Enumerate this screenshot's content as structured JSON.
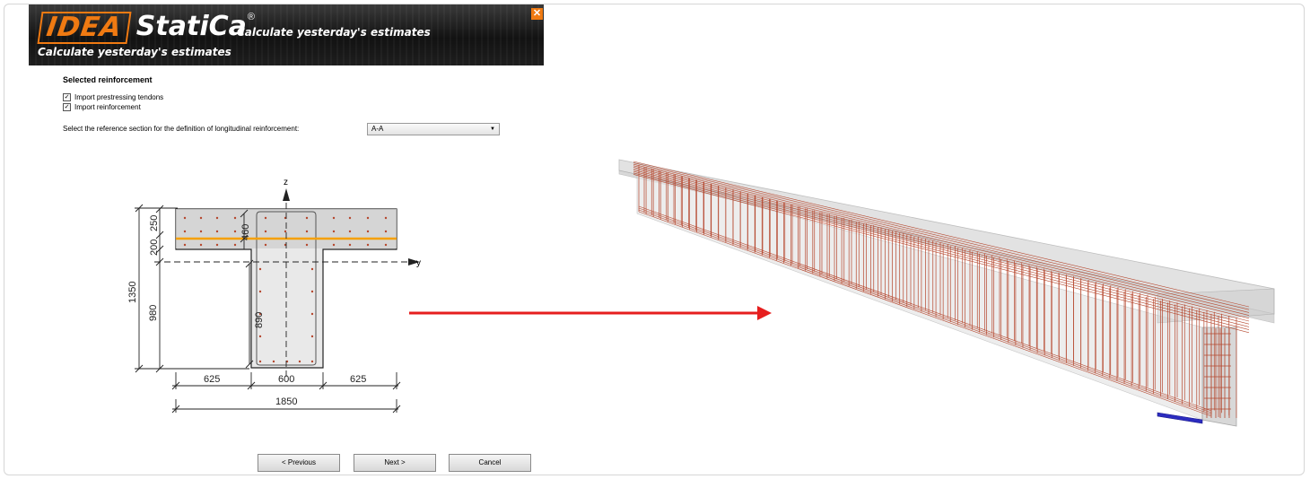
{
  "banner": {
    "logo_idea": "IDEA",
    "logo_statica": "StatiCa",
    "logo_reg": "®",
    "tagline": "Calculate yesterday's estimates",
    "subtitle": "Calculate yesterday's estimates",
    "close_glyph": "✕"
  },
  "dialog": {
    "section_title": "Selected reinforcement",
    "checkboxes": [
      {
        "label": "Import prestressing tendons",
        "checked": true
      },
      {
        "label": "Import reinforcement",
        "checked": true
      }
    ],
    "reference_label": "Select the reference section for the definition of longitudinal reinforcement:",
    "reference_value": "A-A",
    "buttons": {
      "previous": "< Previous",
      "next": "Next >",
      "cancel": "Cancel"
    }
  },
  "section_drawing": {
    "axis_z": "z",
    "axis_y": "y",
    "dims": {
      "flange_top": "250",
      "flange_bottom": "200",
      "tendon": "460",
      "total_height": "1350",
      "web_height": "980",
      "web_inner": "890",
      "left_overhang": "625",
      "web_width": "600",
      "right_overhang": "625",
      "total_width": "1850"
    }
  },
  "colors": {
    "accent_orange": "#f07a12",
    "arrow_red": "#e61e1e",
    "rebar": "#b5472e",
    "tendon": "#f5a000"
  }
}
